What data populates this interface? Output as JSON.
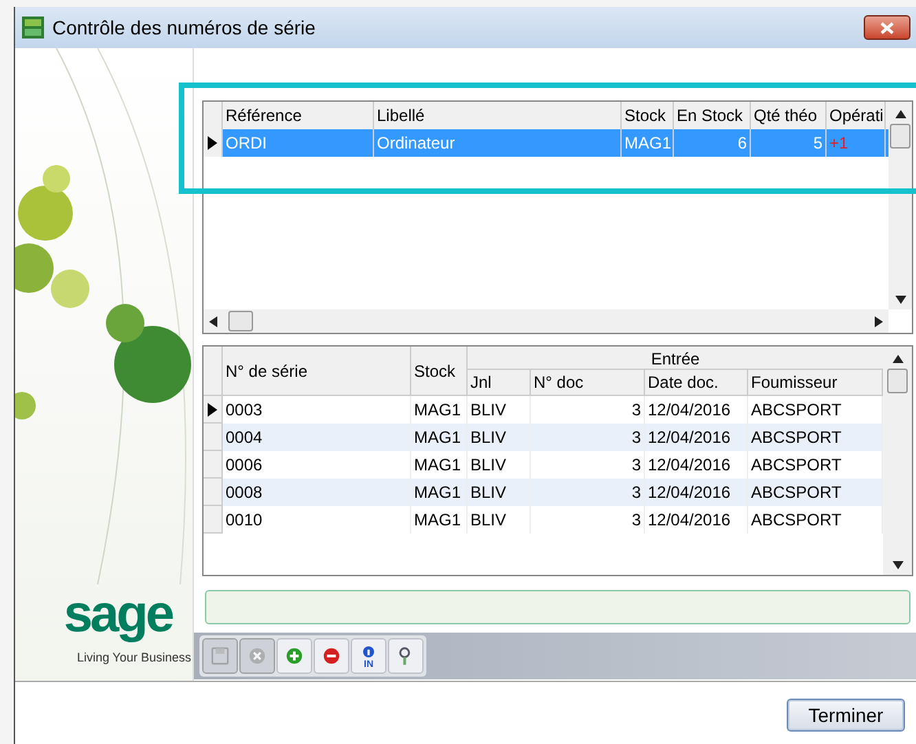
{
  "window": {
    "title": "Contrôle des numéros de série"
  },
  "articles_grid": {
    "columns": [
      "Référence",
      "Libellé",
      "Stock",
      "En Stock",
      "Qté théo",
      "Opérati"
    ],
    "rows": [
      {
        "cells": [
          "ORDI",
          "Ordinateur",
          "MAG1",
          "6",
          "5",
          "+1"
        ],
        "selected": true
      }
    ]
  },
  "serials_grid": {
    "group_header": "Entrée",
    "columns": [
      "N° de série",
      "Stock",
      "Jnl",
      "N° doc",
      "Date doc.",
      "Foumisseur"
    ],
    "rows": [
      {
        "cells": [
          "0003",
          "MAG1",
          "BLIV",
          "3",
          "12/04/2016",
          "ABCSPORT"
        ],
        "selected": true
      },
      {
        "cells": [
          "0004",
          "MAG1",
          "BLIV",
          "3",
          "12/04/2016",
          "ABCSPORT"
        ],
        "selected": false
      },
      {
        "cells": [
          "0006",
          "MAG1",
          "BLIV",
          "3",
          "12/04/2016",
          "ABCSPORT"
        ],
        "selected": false
      },
      {
        "cells": [
          "0008",
          "MAG1",
          "BLIV",
          "3",
          "12/04/2016",
          "ABCSPORT"
        ],
        "selected": false
      },
      {
        "cells": [
          "0010",
          "MAG1",
          "BLIV",
          "3",
          "12/04/2016",
          "ABCSPORT"
        ],
        "selected": false
      }
    ]
  },
  "logo": {
    "wordmark": "sage",
    "tagline": "Living Your Business"
  },
  "toolbar": [
    {
      "kind": "save",
      "disabled": true
    },
    {
      "kind": "cancel",
      "disabled": true
    },
    {
      "kind": "add",
      "disabled": false
    },
    {
      "kind": "remove",
      "disabled": false
    },
    {
      "kind": "info",
      "label": "IN",
      "disabled": false
    },
    {
      "kind": "search",
      "disabled": false
    }
  ],
  "buttons": [
    "Terminer"
  ]
}
